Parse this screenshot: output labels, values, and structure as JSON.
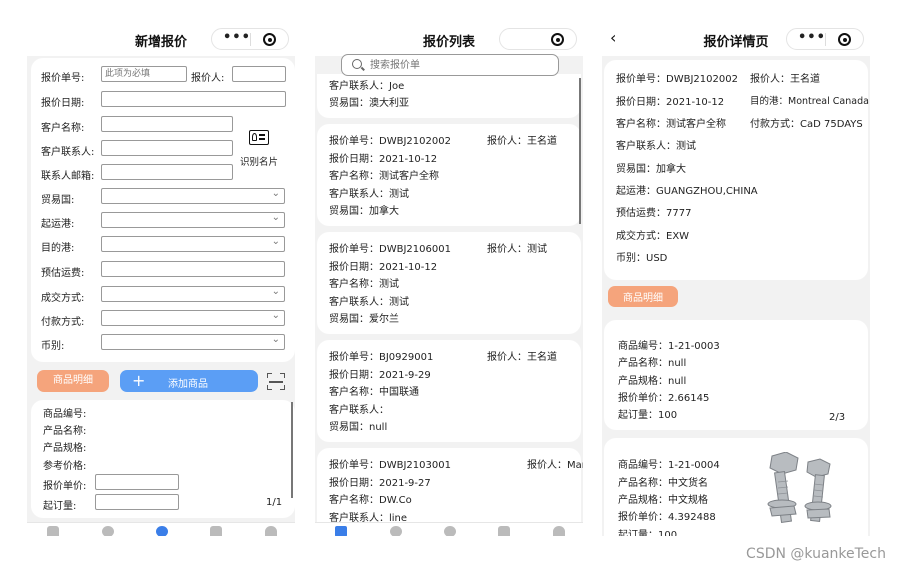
{
  "colors": {
    "accent_blue": "#5b9ef5",
    "accent_orange": "#f5a47c",
    "tab_active": "#3a7ee8",
    "background": "#f2f2f2"
  },
  "capsule": {
    "dots": "•••"
  },
  "screen1": {
    "title": "新增报价",
    "quote_no_label": "报价单号:",
    "quote_no_placeholder": "此项为必填",
    "quoter_label": "报价人:",
    "quote_date_label": "报价日期:",
    "customer_label": "客户名称:",
    "contact_label": "客户联系人:",
    "email_label": "联系人邮箱:",
    "scan_card_label": "识别名片",
    "trade_country_label": "贸易国:",
    "port_load_label": "起运港:",
    "port_dest_label": "目的港:",
    "freight_label": "预估运费:",
    "deal_method_label": "成交方式:",
    "payment_label": "付款方式:",
    "currency_label": "币别:",
    "goods_detail_btn": "商品明细",
    "add_goods_btn": "添加商品",
    "add_plus": "+",
    "product": {
      "code_label": "商品编号:",
      "name_label": "产品名称:",
      "spec_label": "产品规格:",
      "ref_price_label": "参考价格:",
      "unit_price_label": "报价单价:",
      "moq_label": "起订量:",
      "page": "1/1"
    }
  },
  "screen2": {
    "title": "报价列表",
    "search_placeholder": "搜索报价单",
    "partial": {
      "contact": "客户联系人：Joe",
      "country": "贸易国：澳大利亚"
    },
    "quotes": [
      {
        "no": "报价单号：DWBJ2102002",
        "person": "报价人：王名道",
        "date": "报价日期：2021-10-12",
        "customer": "客户名称：测试客户全称",
        "contact": "客户联系人：测试",
        "country": "贸易国：加拿大"
      },
      {
        "no": "报价单号：DWBJ2106001",
        "person": "报价人：测试",
        "date": "报价日期：2021-10-12",
        "customer": "客户名称：测试",
        "contact": "客户联系人：测试",
        "country": "贸易国：爱尔兰"
      },
      {
        "no": "报价单号：BJ0929001",
        "person": "报价人：王名道",
        "date": "报价日期：2021-9-29",
        "customer": "客户名称：中国联通",
        "contact": "客户联系人：",
        "country": "贸易国：null"
      },
      {
        "no": "报价单号：DWBJ2103001",
        "person": "报价人：Mark",
        "date": "报价日期：2021-9-27",
        "customer": "客户名称：DW.Co",
        "contact": "客户联系人：line",
        "country": ""
      }
    ]
  },
  "screen3": {
    "title": "报价详情页",
    "back": "‹",
    "detail": {
      "no": "报价单号：DWBJ2102002",
      "person": "报价人：王名道",
      "date": "报价日期：2021-10-12",
      "dest": "目的港：Montreal Canada",
      "customer": "客户名称：测试客户全称",
      "payment": "付款方式：CaD 75DAYS",
      "contact": "客户联系人：测试",
      "country": "贸易国：加拿大",
      "port": "起运港：GUANGZHOU,CHINA",
      "freight": "预估运费：7777",
      "deal": "成交方式：EXW",
      "currency": "币别：USD"
    },
    "goods_detail_btn": "商品明细",
    "product1": {
      "code": "商品编号：1-21-0003",
      "name": "产品名称：null",
      "spec": "产品规格：null",
      "price": "报价单价：2.66145",
      "moq": "起订量：100",
      "page": "2/3"
    },
    "product2": {
      "code": "商品编号：1-21-0004",
      "name": "产品名称：中文货名",
      "spec": "产品规格：中文规格",
      "price": "报价单价：4.392488",
      "moq": "起订量：100"
    }
  },
  "watermark": "CSDN @kuankeTech"
}
